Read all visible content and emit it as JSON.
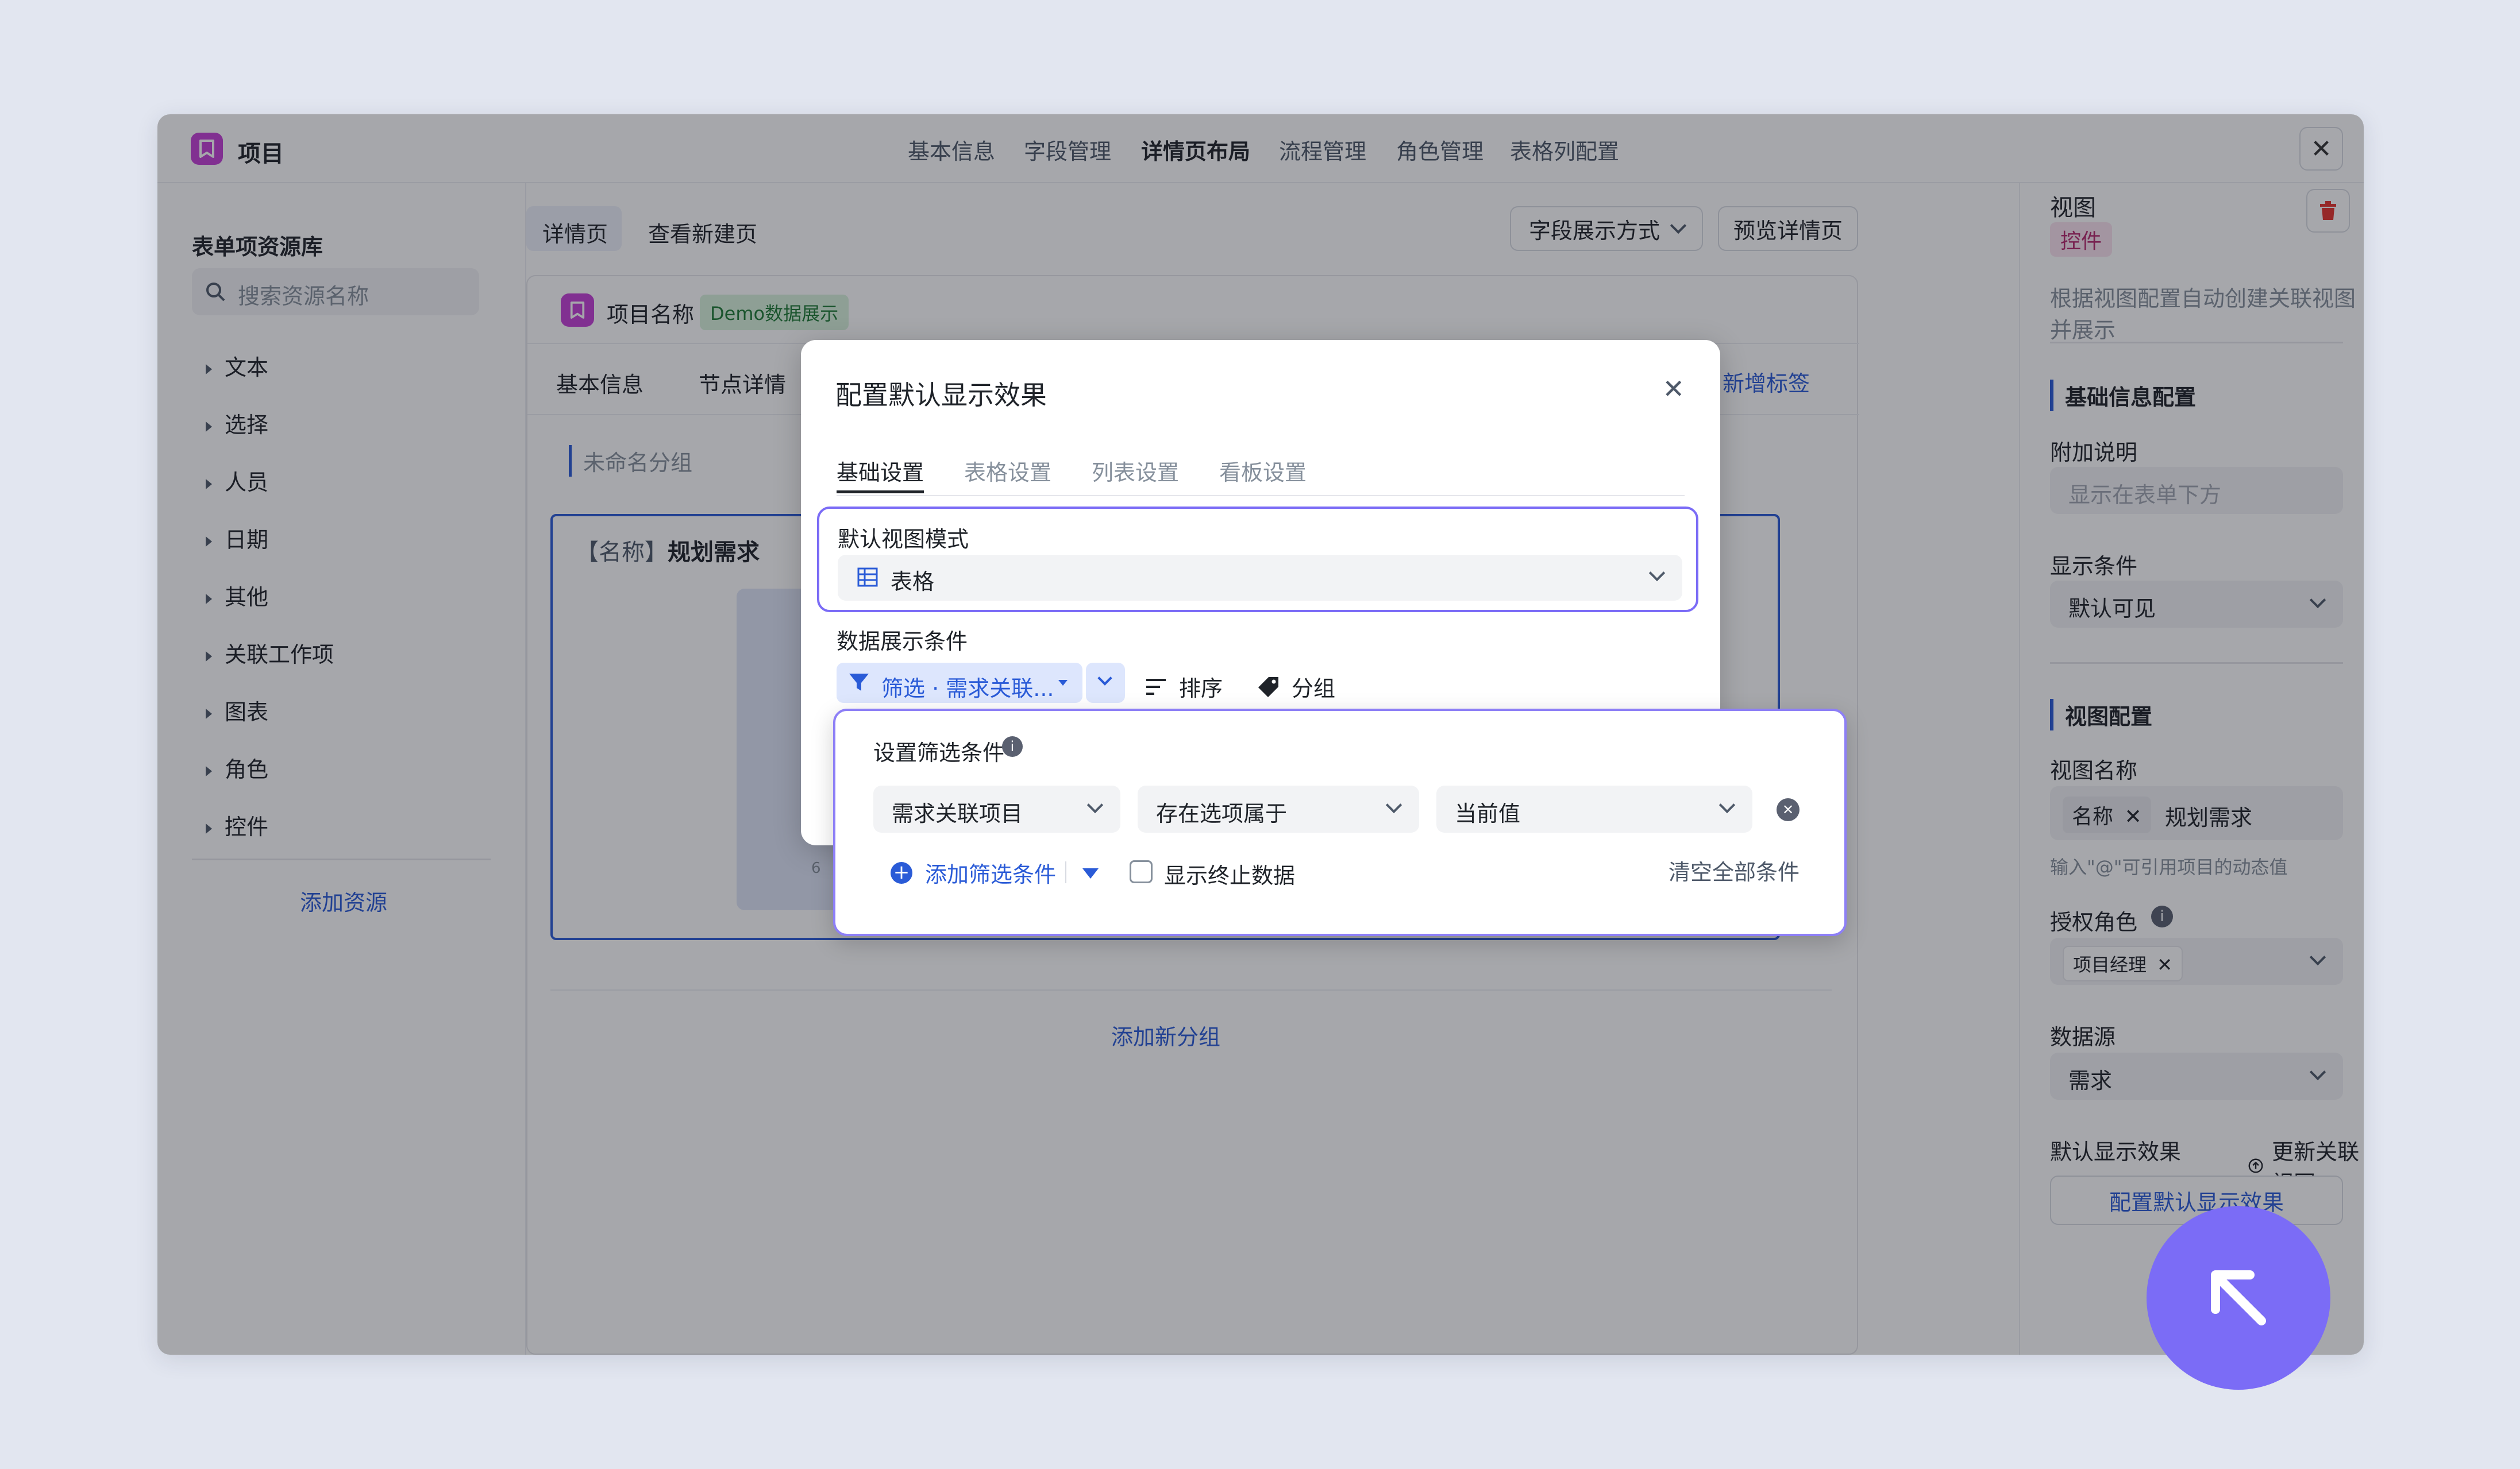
{
  "window": {
    "title": "项目",
    "nav": [
      "基本信息",
      "字段管理",
      "详情页布局",
      "流程管理",
      "角色管理",
      "表格列配置"
    ],
    "active_nav": "详情页布局"
  },
  "left_panel": {
    "title": "表单项资源库",
    "search_placeholder": "搜索资源名称",
    "items": [
      "文本",
      "选择",
      "人员",
      "日期",
      "其他",
      "关联工作项",
      "图表",
      "角色",
      "控件"
    ],
    "add_resource": "添加资源"
  },
  "mid_panel": {
    "tabs": [
      "详情页",
      "查看新建页"
    ],
    "field_display_btn": "字段展示方式",
    "preview_btn": "预览详情页",
    "card_title": "项目名称",
    "demo_badge": "Demo数据展示",
    "sub_tabs": [
      "基本信息",
      "节点详情"
    ],
    "add_tag": "新增标签",
    "group_name": "未命名分组",
    "field_prefix": "【名称】",
    "field_value": "规划需求",
    "row_number": "6",
    "add_group": "添加新分组"
  },
  "right_panel": {
    "title": "视图",
    "badge": "控件",
    "description": "根据视图配置自动创建关联视图并展示",
    "basic_section": "基础信息配置",
    "note_label": "附加说明",
    "note_placeholder": "显示在表单下方",
    "cond_label": "显示条件",
    "cond_value": "默认可见",
    "view_section": "视图配置",
    "view_name_label": "视图名称",
    "view_name_tag": "名称",
    "view_name_value": "规划需求",
    "view_name_hint": "输入\"@\"可引用项目的动态值",
    "role_label": "授权角色",
    "role_tag": "项目经理",
    "source_label": "数据源",
    "source_value": "需求",
    "default_label": "默认显示效果",
    "update_btn": "更新关联视图",
    "config_btn": "配置默认显示效果"
  },
  "modal": {
    "title": "配置默认显示效果",
    "tabs": [
      "基础设置",
      "表格设置",
      "列表设置",
      "看板设置"
    ],
    "view_mode_label": "默认视图模式",
    "view_mode_value": "表格",
    "data_cond_label": "数据展示条件",
    "filter_chip": "筛选 · 需求关联...",
    "sort_btn": "排序",
    "group_btn": "分组"
  },
  "popup": {
    "title": "设置筛选条件",
    "field": "需求关联项目",
    "operator": "存在选项属于",
    "value": "当前值",
    "add_condition": "添加筛选条件",
    "show_ended": "显示终止数据",
    "clear_all": "清空全部条件"
  },
  "colors": {
    "accent": "#2a5bd7",
    "violet": "#7b6cf6",
    "logo": "#c43fd6",
    "danger": "#e5322d"
  }
}
